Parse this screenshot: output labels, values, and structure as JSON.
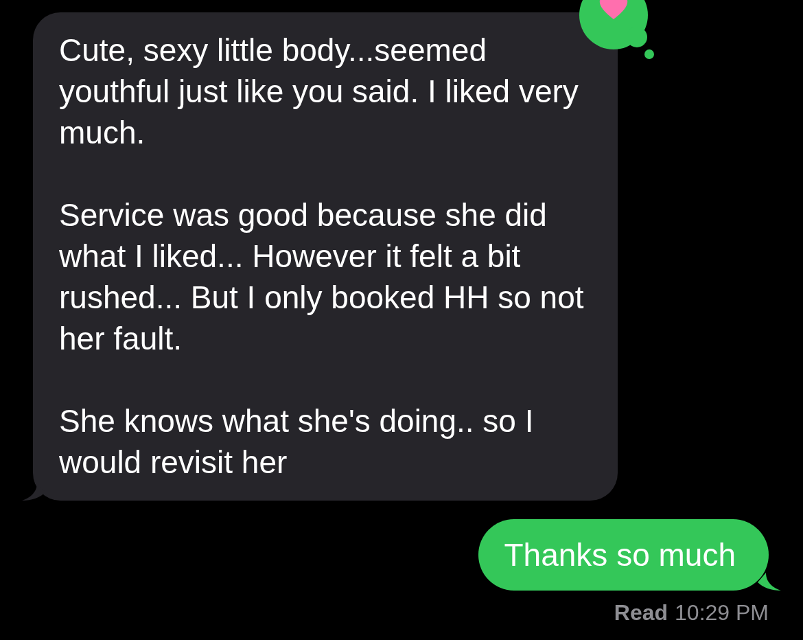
{
  "messages": [
    {
      "kind": "incoming",
      "paragraphs": [
        "Cute, sexy little body...seemed youthful just like you said. I liked very much.",
        "Service was good because she did what I liked... However it felt a bit rushed... But I only booked HH so not her fault.",
        "She knows what she's doing.. so I would revisit her"
      ],
      "tapback": {
        "kind": "heart"
      }
    },
    {
      "kind": "outgoing",
      "paragraphs": [
        "Thanks so much"
      ]
    }
  ],
  "receipt": {
    "status": "Read",
    "time": "10:29 PM"
  }
}
